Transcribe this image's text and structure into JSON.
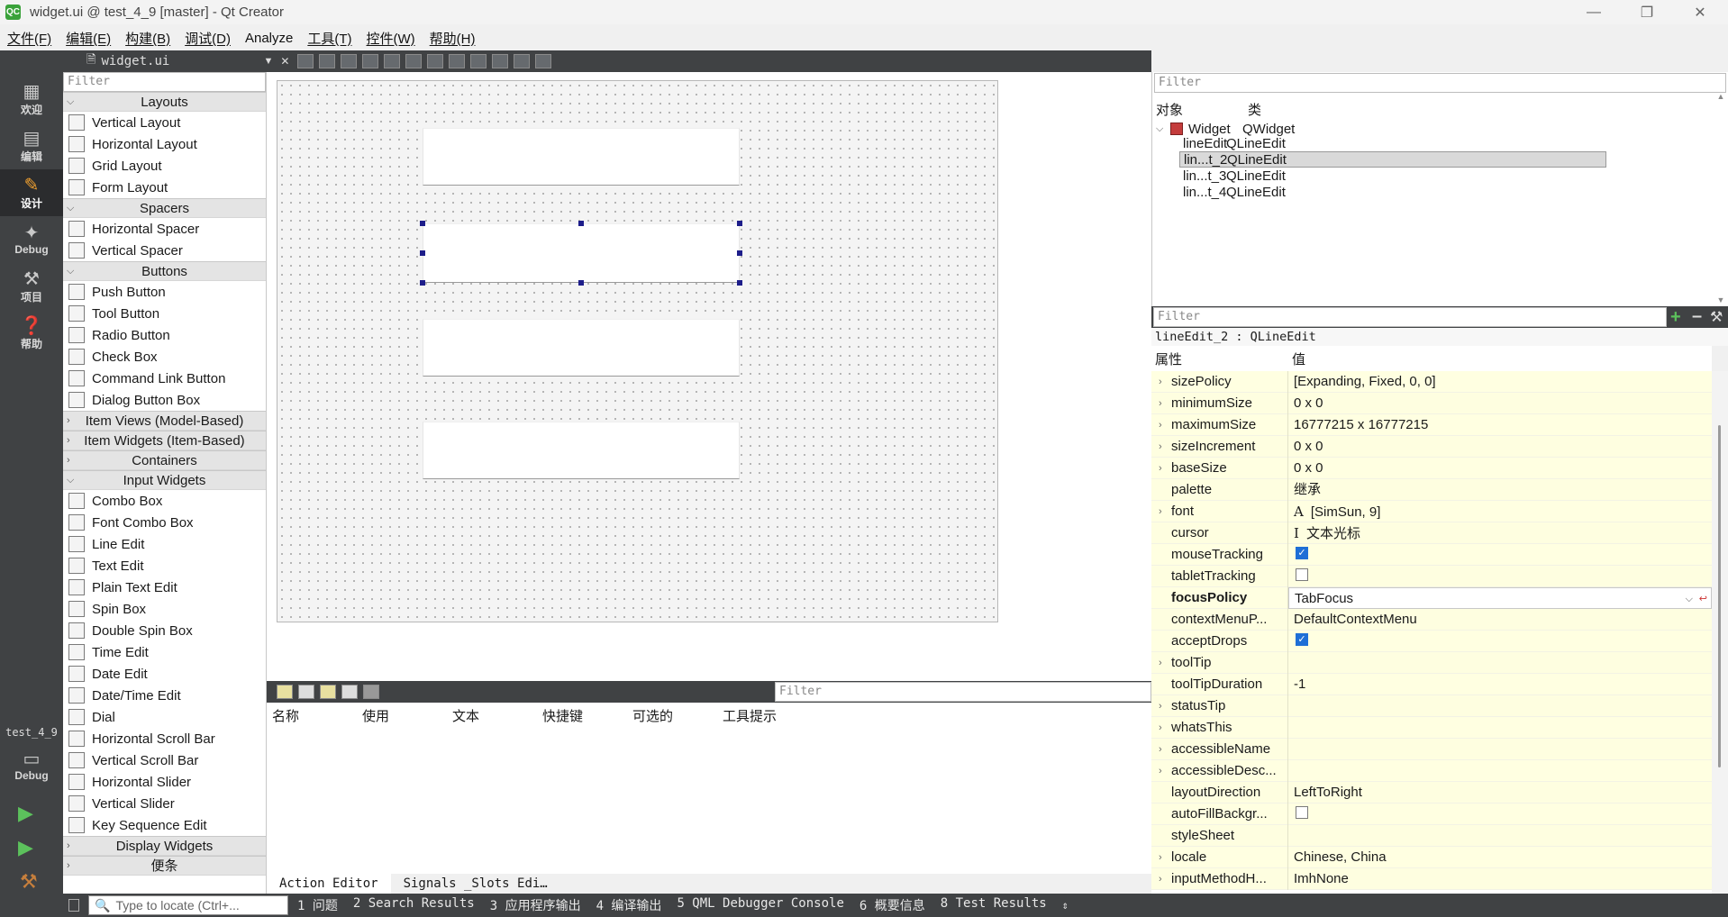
{
  "window": {
    "title": "widget.ui @ test_4_9 [master] - Qt Creator",
    "app_icon": "QC"
  },
  "menu": [
    "文件(F)",
    "编辑(E)",
    "构建(B)",
    "调试(D)",
    "Analyze",
    "工具(T)",
    "控件(W)",
    "帮助(H)"
  ],
  "modes": [
    {
      "label": "欢迎",
      "icon": "grid-icon"
    },
    {
      "label": "编辑",
      "icon": "document-icon"
    },
    {
      "label": "设计",
      "icon": "pencil-icon"
    },
    {
      "label": "Debug",
      "icon": "bug-icon"
    },
    {
      "label": "项目",
      "icon": "wrench-icon"
    },
    {
      "label": "帮助",
      "icon": "help-icon"
    }
  ],
  "kit": {
    "project": "test_4_9",
    "mode": "Debug"
  },
  "editor": {
    "file_name": "widget.ui"
  },
  "widget_box": {
    "filter_placeholder": "Filter",
    "layouts_label": "Layouts",
    "layouts": [
      "Vertical Layout",
      "Horizontal Layout",
      "Grid Layout",
      "Form Layout"
    ],
    "spacers_label": "Spacers",
    "spacers": [
      "Horizontal Spacer",
      "Vertical Spacer"
    ],
    "buttons_label": "Buttons",
    "buttons": [
      "Push Button",
      "Tool Button",
      "Radio Button",
      "Check Box",
      "Command Link Button",
      "Dialog Button Box"
    ],
    "item_views_label": "Item Views (Model-Based)",
    "item_widgets_label": "Item Widgets (Item-Based)",
    "containers_label": "Containers",
    "input_label": "Input Widgets",
    "inputs": [
      "Combo Box",
      "Font Combo Box",
      "Line Edit",
      "Text Edit",
      "Plain Text Edit",
      "Spin Box",
      "Double Spin Box",
      "Time Edit",
      "Date Edit",
      "Date/Time Edit",
      "Dial",
      "Horizontal Scroll Bar",
      "Vertical Scroll Bar",
      "Horizontal Slider",
      "Vertical Slider",
      "Key Sequence Edit"
    ],
    "display_label": "Display Widgets",
    "misc_label": "便条"
  },
  "action_editor": {
    "filter_placeholder": "Filter",
    "columns": [
      "名称",
      "使用",
      "文本",
      "快捷键",
      "可选的",
      "工具提示"
    ],
    "tabs": [
      "Action Editor",
      "Signals _Slots Edi…"
    ]
  },
  "object_inspector": {
    "filter_placeholder": "Filter",
    "col_object": "对象",
    "col_class": "类",
    "root": {
      "name": "Widget",
      "class": "QWidget"
    },
    "children": [
      {
        "name": "lineEdit",
        "class": "QLineEdit"
      },
      {
        "name": "lin...t_2",
        "class": "QLineEdit",
        "selected": true
      },
      {
        "name": "lin...t_3",
        "class": "QLineEdit"
      },
      {
        "name": "lin...t_4",
        "class": "QLineEdit"
      }
    ]
  },
  "property_editor": {
    "filter_placeholder": "Filter",
    "object_label": "lineEdit_2 : QLineEdit",
    "col_property": "属性",
    "col_value": "值",
    "rows": [
      {
        "name": "sizePolicy",
        "value": "[Expanding, Fixed, 0, 0]",
        "expand": true
      },
      {
        "name": "minimumSize",
        "value": "0 x 0",
        "expand": true
      },
      {
        "name": "maximumSize",
        "value": "16777215 x 16777215",
        "expand": true
      },
      {
        "name": "sizeIncrement",
        "value": "0 x 0",
        "expand": true
      },
      {
        "name": "baseSize",
        "value": "0 x 0",
        "expand": true
      },
      {
        "name": "palette",
        "value": "继承"
      },
      {
        "name": "font",
        "value": "[SimSun, 9]",
        "expand": true,
        "icon": "A"
      },
      {
        "name": "cursor",
        "value": "文本光标",
        "icon": "I"
      },
      {
        "name": "mouseTracking",
        "check": true
      },
      {
        "name": "tabletTracking",
        "check": false
      },
      {
        "name": "focusPolicy",
        "value": "TabFocus",
        "bold": true,
        "combo": true
      },
      {
        "name": "contextMenuP...",
        "value": "DefaultContextMenu"
      },
      {
        "name": "acceptDrops",
        "check": true
      },
      {
        "name": "toolTip",
        "value": "",
        "expand": true
      },
      {
        "name": "toolTipDuration",
        "value": "-1"
      },
      {
        "name": "statusTip",
        "value": "",
        "expand": true
      },
      {
        "name": "whatsThis",
        "value": "",
        "expand": true
      },
      {
        "name": "accessibleName",
        "value": "",
        "expand": true
      },
      {
        "name": "accessibleDesc...",
        "value": "",
        "expand": true
      },
      {
        "name": "layoutDirection",
        "value": "LeftToRight"
      },
      {
        "name": "autoFillBackgr...",
        "check": false
      },
      {
        "name": "styleSheet",
        "value": ""
      },
      {
        "name": "locale",
        "value": "Chinese, China",
        "expand": true
      },
      {
        "name": "inputMethodH...",
        "value": "ImhNone",
        "expand": true
      }
    ]
  },
  "statusbar": {
    "locator_placeholder": "Type to locate (Ctrl+...",
    "items": [
      "1 问题",
      "2 Search Results",
      "3 应用程序输出",
      "4 编译输出",
      "5 QML Debugger Console",
      "6 概要信息",
      "8 Test Results"
    ]
  },
  "colors": {
    "mode_bar": "#404244",
    "selection_handle": "#1d1d8a",
    "property_row_bg": "#ffffe1",
    "property_row_alt": "#fefee0",
    "accent_green": "#3aa23a"
  }
}
